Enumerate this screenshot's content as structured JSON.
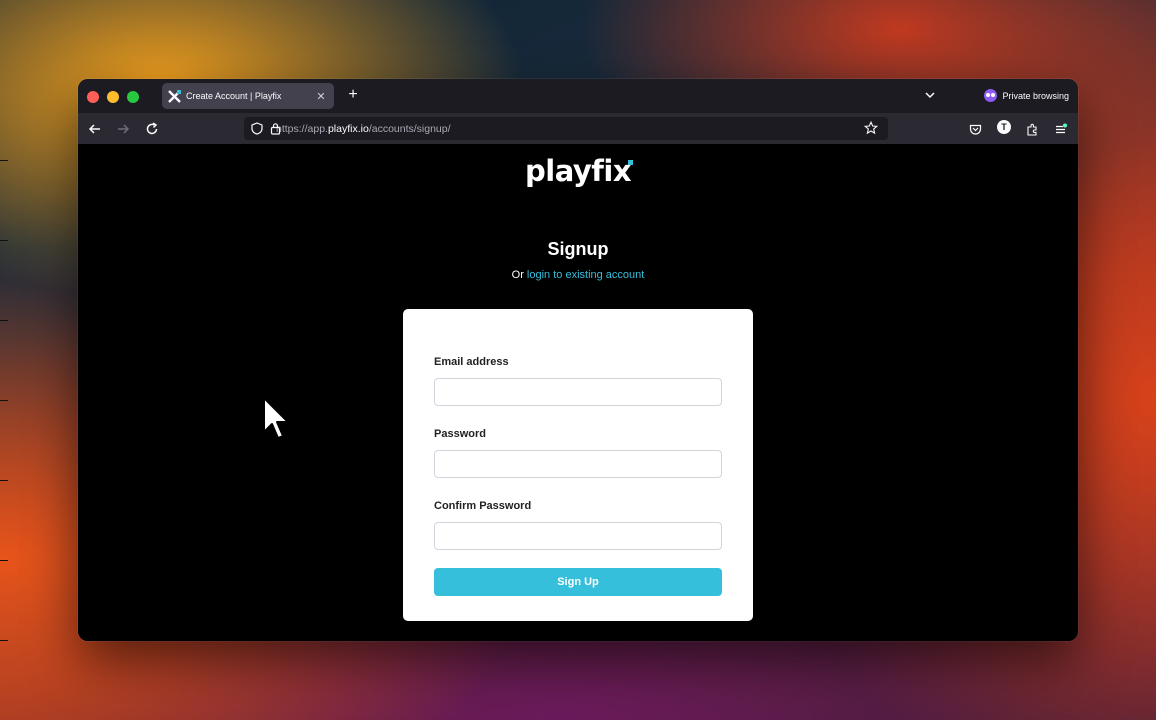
{
  "browser": {
    "tab": {
      "title": "Create Account | Playfix"
    },
    "private_label": "Private browsing",
    "url": {
      "prefix": "https://app.",
      "host": "playfix.io",
      "path": "/accounts/signup/"
    },
    "account_initial": "T"
  },
  "page": {
    "logo": "playfix",
    "title": "Signup",
    "or_prefix": "Or ",
    "login_link": "login to existing account",
    "form": {
      "email_label": "Email address",
      "password_label": "Password",
      "confirm_label": "Confirm Password",
      "submit_label": "Sign Up"
    }
  },
  "colors": {
    "accent": "#35bfdb",
    "window_bg": "#000000",
    "card_bg": "#ffffff"
  }
}
